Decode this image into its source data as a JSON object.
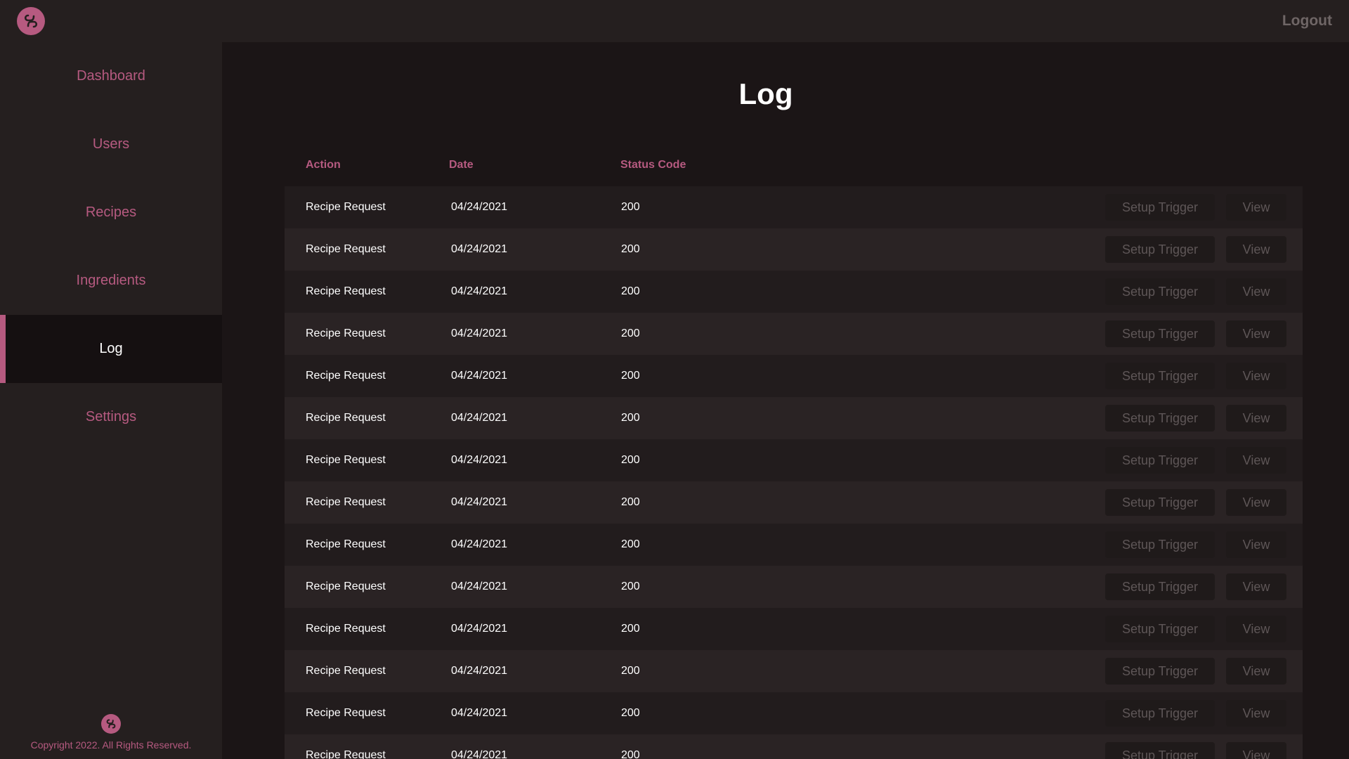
{
  "header": {
    "logout_label": "Logout"
  },
  "sidebar": {
    "items": [
      {
        "label": "Dashboard",
        "active": false
      },
      {
        "label": "Users",
        "active": false
      },
      {
        "label": "Recipes",
        "active": false
      },
      {
        "label": "Ingredients",
        "active": false
      },
      {
        "label": "Log",
        "active": true
      },
      {
        "label": "Settings",
        "active": false
      }
    ],
    "copyright": "Copyright 2022. All Rights Reserved."
  },
  "main": {
    "title": "Log",
    "columns": [
      "Action",
      "Date",
      "Status Code"
    ],
    "rows": [
      {
        "action": "Recipe Request",
        "date": "04/24/2021",
        "status": "200"
      },
      {
        "action": "Recipe Request",
        "date": "04/24/2021",
        "status": "200"
      },
      {
        "action": "Recipe Request",
        "date": "04/24/2021",
        "status": "200"
      },
      {
        "action": "Recipe Request",
        "date": "04/24/2021",
        "status": "200"
      },
      {
        "action": "Recipe Request",
        "date": "04/24/2021",
        "status": "200"
      },
      {
        "action": "Recipe Request",
        "date": "04/24/2021",
        "status": "200"
      },
      {
        "action": "Recipe Request",
        "date": "04/24/2021",
        "status": "200"
      },
      {
        "action": "Recipe Request",
        "date": "04/24/2021",
        "status": "200"
      },
      {
        "action": "Recipe Request",
        "date": "04/24/2021",
        "status": "200"
      },
      {
        "action": "Recipe Request",
        "date": "04/24/2021",
        "status": "200"
      },
      {
        "action": "Recipe Request",
        "date": "04/24/2021",
        "status": "200"
      },
      {
        "action": "Recipe Request",
        "date": "04/24/2021",
        "status": "200"
      },
      {
        "action": "Recipe Request",
        "date": "04/24/2021",
        "status": "200"
      },
      {
        "action": "Recipe Request",
        "date": "04/24/2021",
        "status": "200"
      }
    ],
    "setup_trigger_label": "Setup Trigger",
    "view_label": "View"
  },
  "icons": {
    "app_logo": "swirl-logo-icon"
  },
  "colors": {
    "accent": "#b65a80",
    "background": "#1b1516",
    "panel": "#251f1f"
  }
}
